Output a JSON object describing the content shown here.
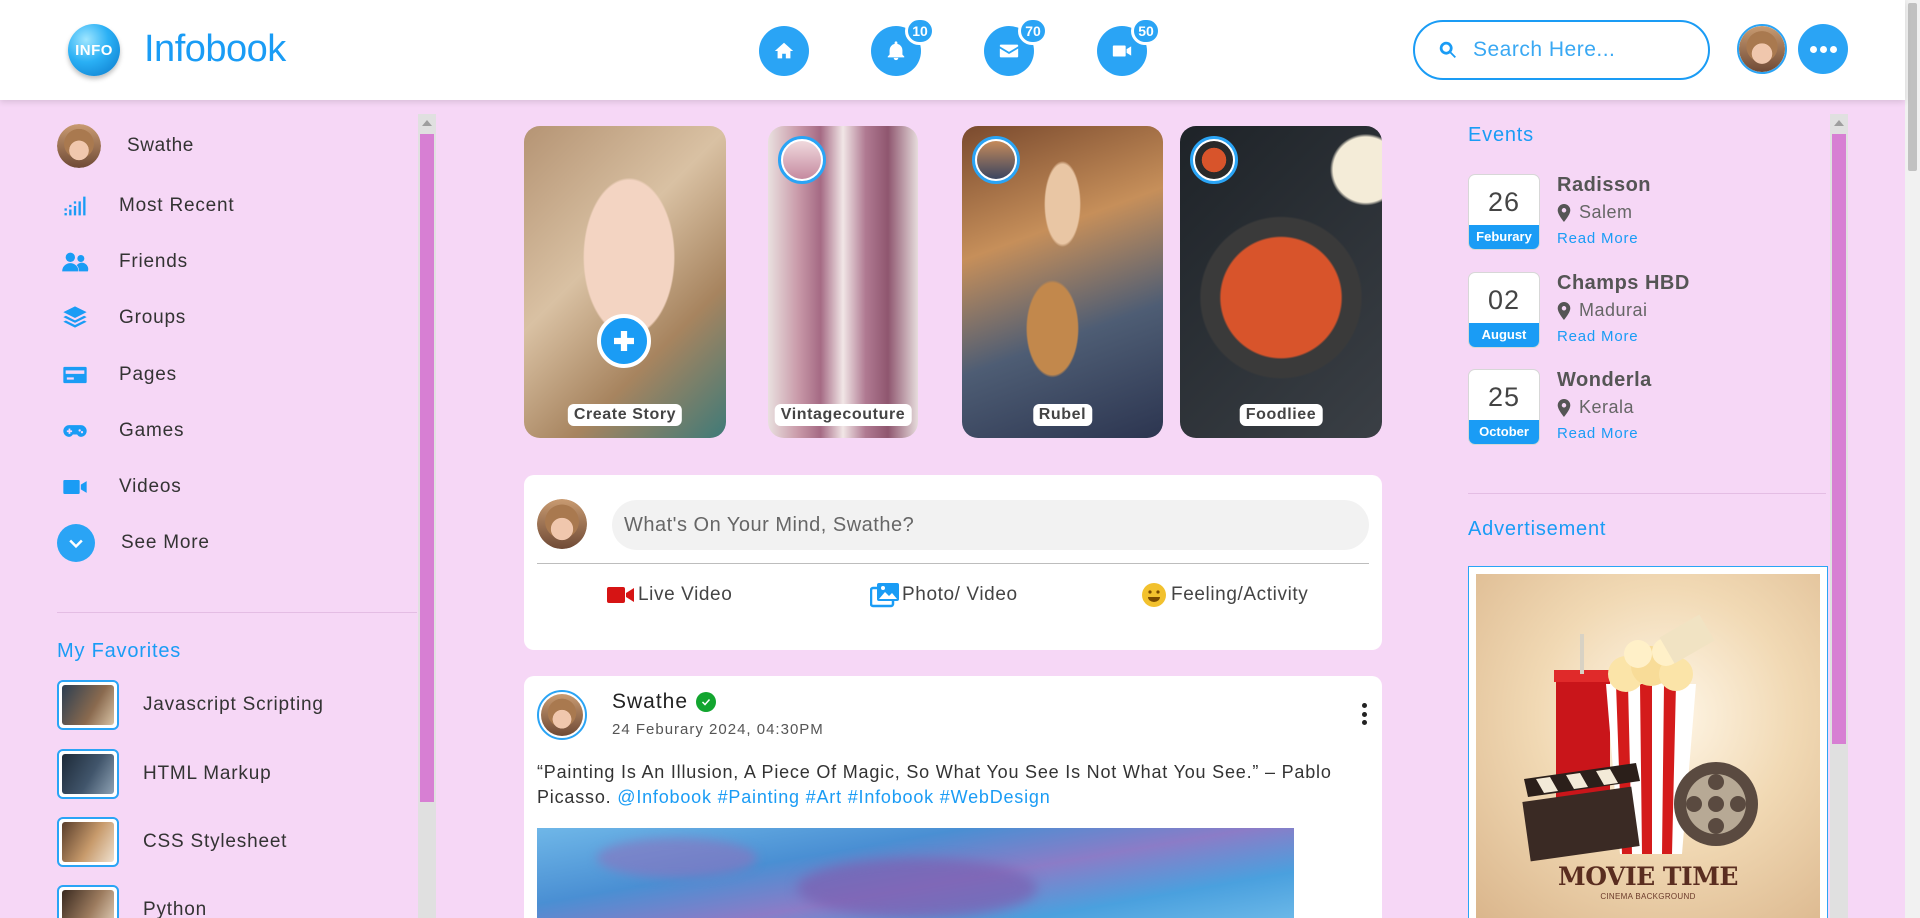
{
  "header": {
    "logo_badge": "INFO",
    "logo_text": "Infobook",
    "notifications": [
      {
        "name": "home",
        "icon": "home-icon",
        "badge": ""
      },
      {
        "name": "alerts",
        "icon": "bell-icon",
        "badge": "10"
      },
      {
        "name": "messages",
        "icon": "envelope-icon",
        "badge": "70"
      },
      {
        "name": "videos",
        "icon": "video-camera-icon",
        "badge": "50"
      }
    ],
    "search_placeholder": "Search Here..."
  },
  "left_sidebar": {
    "profile_name": "Swathe",
    "items": [
      {
        "label": "Most Recent",
        "icon": "bars-chart-icon"
      },
      {
        "label": "Friends",
        "icon": "users-icon"
      },
      {
        "label": "Groups",
        "icon": "layers-icon"
      },
      {
        "label": "Pages",
        "icon": "card-icon"
      },
      {
        "label": "Games",
        "icon": "gamepad-icon"
      },
      {
        "label": "Videos",
        "icon": "video-camera-icon"
      },
      {
        "label": "See More",
        "icon": "chevron-down-icon"
      }
    ],
    "favorites_title": "My Favorites",
    "favorites": [
      {
        "label": "Javascript Scripting"
      },
      {
        "label": "HTML Markup"
      },
      {
        "label": "CSS Stylesheet"
      },
      {
        "label": "Python"
      }
    ]
  },
  "stories": [
    {
      "label": "Create Story"
    },
    {
      "label": "Vintagecouture"
    },
    {
      "label": "Rubel"
    },
    {
      "label": "Foodliee"
    }
  ],
  "composer": {
    "placeholder": "What's On Your Mind, Swathe?",
    "actions": [
      {
        "label": "Live Video",
        "icon": "live-video-icon"
      },
      {
        "label": "Photo/ Video",
        "icon": "photos-icon"
      },
      {
        "label": "Feeling/Activity",
        "icon": "smiley-icon"
      }
    ]
  },
  "post": {
    "author": "Swathe",
    "timestamp": "24 Feburary 2024, 04:30PM",
    "text": "“Painting Is An Illusion, A Piece Of Magic, So What You See Is Not What You See.” – Pablo Picasso.",
    "tags": [
      "@Infobook",
      "#Painting",
      "#Art",
      "#Infobook",
      "#WebDesign"
    ]
  },
  "right_sidebar": {
    "events_title": "Events",
    "events": [
      {
        "day": "26",
        "month": "Feburary",
        "name": "Radisson",
        "location": "Salem",
        "link": "Read More"
      },
      {
        "day": "02",
        "month": "August",
        "name": "Champs HBD",
        "location": "Madurai",
        "link": "Read More"
      },
      {
        "day": "25",
        "month": "October",
        "name": "Wonderla",
        "location": "Kerala",
        "link": "Read More"
      }
    ],
    "ad_title": "Advertisement",
    "ad_headline": "MOVIE TIME",
    "ad_subline": "CINEMA BACKGROUND"
  },
  "colors": {
    "accent": "#1a9cf5",
    "background": "#f6d7f6",
    "scroll_thumb": "#d77fd3",
    "verified": "#12a52f"
  }
}
